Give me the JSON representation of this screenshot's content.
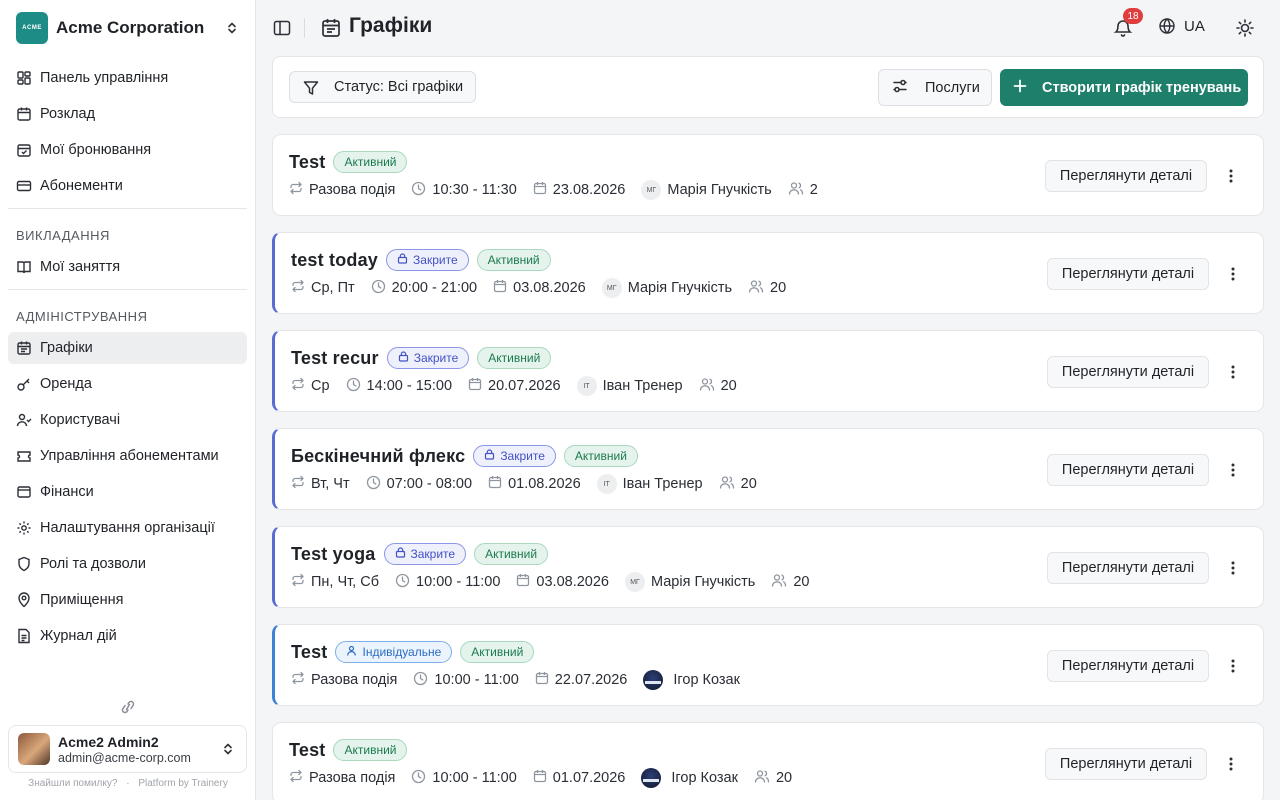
{
  "org": {
    "logo_text": "ACME",
    "name": "Acme Corporation"
  },
  "nav": {
    "main": [
      {
        "label": "Панель управління",
        "icon": "dashboard-icon"
      },
      {
        "label": "Розклад",
        "icon": "calendar-icon"
      },
      {
        "label": "Мої бронювання",
        "icon": "bookmark-icon"
      },
      {
        "label": "Абонементи",
        "icon": "ticket-icon"
      }
    ],
    "teaching_title": "ВИКЛАДАННЯ",
    "teaching": [
      {
        "label": "Мої заняття",
        "icon": "book-icon"
      }
    ],
    "admin_title": "АДМІНІСТРУВАННЯ",
    "admin": [
      {
        "label": "Графіки",
        "icon": "calendar-range-icon",
        "active": true
      },
      {
        "label": "Оренда",
        "icon": "key-icon"
      },
      {
        "label": "Користувачі",
        "icon": "users-icon"
      },
      {
        "label": "Управління абонементами",
        "icon": "ticket-settings-icon"
      },
      {
        "label": "Фінанси",
        "icon": "wallet-icon"
      },
      {
        "label": "Налаштування організації",
        "icon": "settings-icon"
      },
      {
        "label": "Ролі та дозволи",
        "icon": "shield-icon"
      },
      {
        "label": "Приміщення",
        "icon": "map-pin-icon"
      },
      {
        "label": "Журнал дій",
        "icon": "file-list-icon"
      }
    ]
  },
  "user": {
    "name": "Acme2 Admin2",
    "email": "admin@acme-corp.com"
  },
  "footer": {
    "report": "Знайшли помилку?",
    "dot": "·",
    "platform": "Platform by Trainery"
  },
  "header": {
    "title": "Графіки",
    "notifications": "18",
    "lang": "UA"
  },
  "toolbar": {
    "filter_label": "Статус: Всі графіки",
    "services_label": "Послуги",
    "create_label": "Створити графік тренувань"
  },
  "cards": [
    {
      "title": "Test",
      "tags": [
        "Активний"
      ],
      "closed": false,
      "individual": false,
      "recurrence": "Разова подія",
      "time": "10:30 - 11:30",
      "date": "23.08.2026",
      "trainer_initials": "МГ",
      "trainer_photo": false,
      "trainer": "Марія Гнучкість",
      "capacity": "2"
    },
    {
      "title": "test today",
      "tags": [
        "Активний"
      ],
      "closed": true,
      "individual": false,
      "recurrence": "Ср, Пт",
      "time": "20:00 - 21:00",
      "date": "03.08.2026",
      "trainer_initials": "МГ",
      "trainer_photo": false,
      "trainer": "Марія Гнучкість",
      "capacity": "20"
    },
    {
      "title": "Test recur",
      "tags": [
        "Активний"
      ],
      "closed": true,
      "individual": false,
      "recurrence": "Ср",
      "time": "14:00 - 15:00",
      "date": "20.07.2026",
      "trainer_initials": "IT",
      "trainer_photo": false,
      "trainer": "Іван Тренер",
      "capacity": "20"
    },
    {
      "title": "Бескінечний флекс",
      "tags": [
        "Активний"
      ],
      "closed": true,
      "individual": false,
      "recurrence": "Вт, Чт",
      "time": "07:00 - 08:00",
      "date": "01.08.2026",
      "trainer_initials": "IT",
      "trainer_photo": false,
      "trainer": "Іван Тренер",
      "capacity": "20"
    },
    {
      "title": "Test yoga",
      "tags": [
        "Активний"
      ],
      "closed": true,
      "individual": false,
      "recurrence": "Пн, Чт, Сб",
      "time": "10:00 - 11:00",
      "date": "03.08.2026",
      "trainer_initials": "МГ",
      "trainer_photo": false,
      "trainer": "Марія Гнучкість",
      "capacity": "20"
    },
    {
      "title": "Test",
      "tags": [
        "Активний"
      ],
      "closed": false,
      "individual": true,
      "recurrence": "Разова подія",
      "time": "10:00 - 11:00",
      "date": "22.07.2026",
      "trainer_initials": "",
      "trainer_photo": true,
      "trainer": "Ігор Козак",
      "capacity": ""
    },
    {
      "title": "Test",
      "tags": [
        "Активний"
      ],
      "closed": false,
      "individual": false,
      "recurrence": "Разова подія",
      "time": "10:00 - 11:00",
      "date": "01.07.2026",
      "trainer_initials": "",
      "trainer_photo": true,
      "trainer": "Ігор Козак",
      "capacity": "20"
    }
  ],
  "labels": {
    "closed": "Закрите",
    "individual": "Індивідуальне",
    "details": "Переглянути деталі"
  },
  "colors": {
    "primary": "#1e7f6b",
    "active_bg": "#e4f3ec",
    "closed_accent": "#5b6bd6",
    "individual_accent": "#3b82d6",
    "badge": "#e03e3e"
  }
}
